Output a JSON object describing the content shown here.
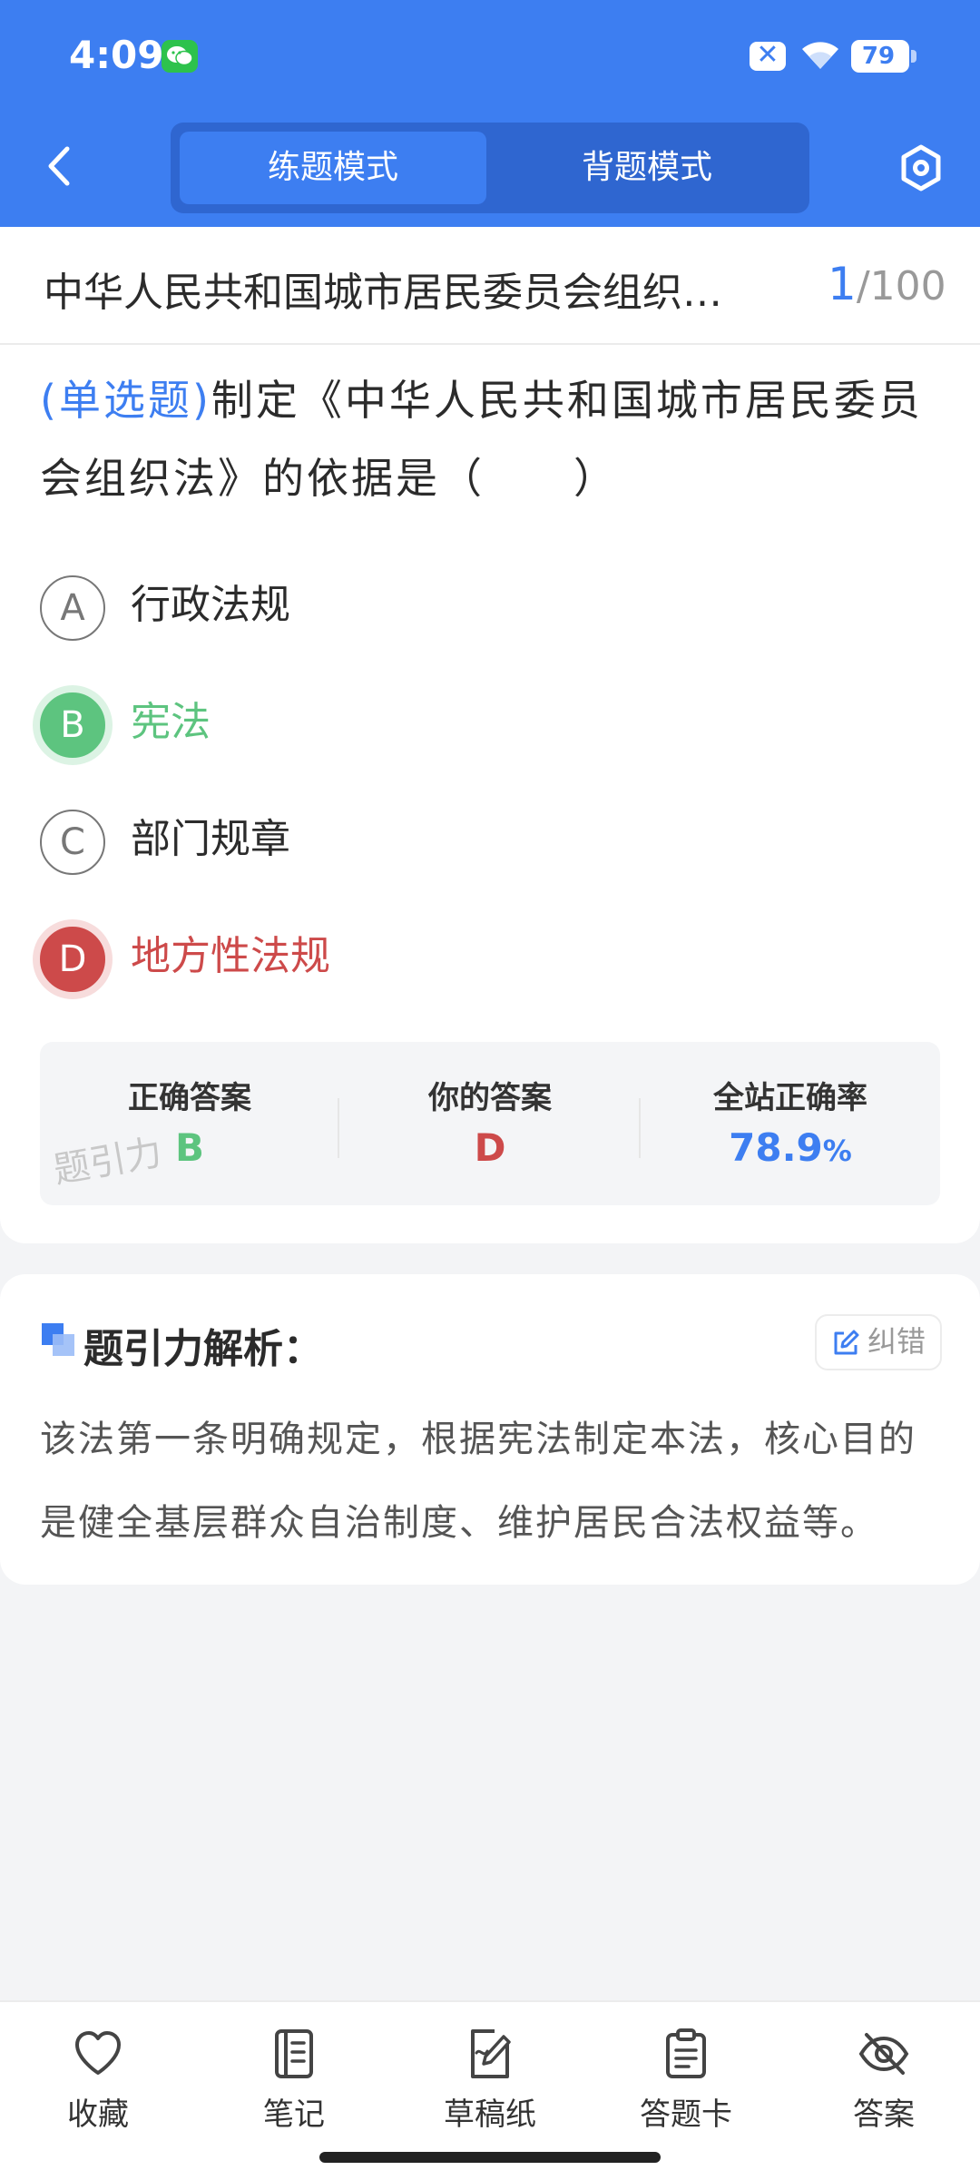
{
  "status_bar": {
    "time": "4:09",
    "battery": "79",
    "close_glyph": "✕"
  },
  "header": {
    "tabs": [
      {
        "label": "练题模式",
        "active": true
      },
      {
        "label": "背题模式",
        "active": false
      }
    ],
    "icons": {
      "back": "chevron-left-icon",
      "settings": "hexagon-settings-icon"
    }
  },
  "question": {
    "topic": "中华人民共和国城市居民委员会组织…",
    "current": "1",
    "total": "/100",
    "type": "(单选题)",
    "text": "制定《中华人民共和国城市居民委员会组织法》的依据是（　　）",
    "options": [
      {
        "letter": "A",
        "text": "行政法规",
        "state": "normal"
      },
      {
        "letter": "B",
        "text": "宪法",
        "state": "correct"
      },
      {
        "letter": "C",
        "text": "部门规章",
        "state": "normal"
      },
      {
        "letter": "D",
        "text": "地方性法规",
        "state": "wrong"
      }
    ]
  },
  "result": {
    "correct_label": "正确答案",
    "correct_value": "B",
    "yours_label": "你的答案",
    "yours_value": "D",
    "rate_label": "全站正确率",
    "rate_value": "78.9",
    "rate_unit": "%",
    "watermark": "题引力"
  },
  "analysis": {
    "title": "题引力解析：",
    "correction_label": "纠错",
    "text": "该法第一条明确规定，根据宪法制定本法，核心目的是健全基层群众自治制度、维护居民合法权益等。"
  },
  "bottom_nav": [
    {
      "label": "收藏",
      "icon": "heart-icon"
    },
    {
      "label": "笔记",
      "icon": "notebook-icon"
    },
    {
      "label": "草稿纸",
      "icon": "draft-paper-icon"
    },
    {
      "label": "答题卡",
      "icon": "answer-card-icon"
    },
    {
      "label": "答案",
      "icon": "eye-off-icon"
    }
  ],
  "colors": {
    "primary": "#3d7ef1",
    "correct": "#5dc47f",
    "wrong": "#cd4a4a"
  }
}
